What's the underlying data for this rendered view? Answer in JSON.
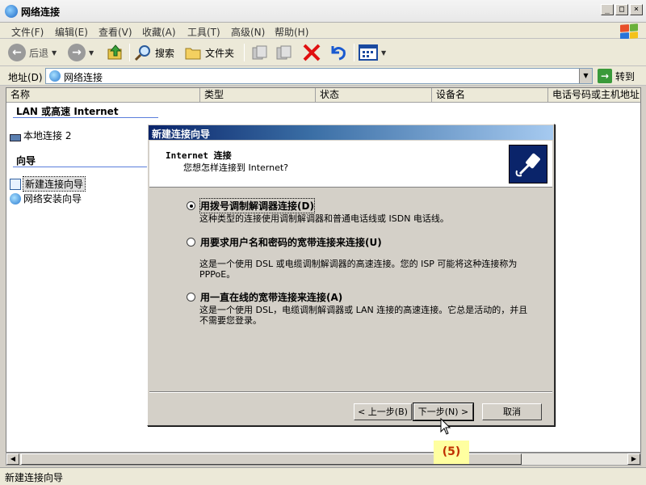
{
  "window": {
    "title": "网络连接"
  },
  "menu": [
    "文件(F)",
    "编辑(E)",
    "查看(V)",
    "收藏(A)",
    "工具(T)",
    "高级(N)",
    "帮助(H)"
  ],
  "toolbar": {
    "back": "后退",
    "search": "搜索",
    "folders": "文件夹"
  },
  "address": {
    "label": "地址(D)",
    "value": "网络连接",
    "go": "转到"
  },
  "columns": [
    "名称",
    "类型",
    "状态",
    "设备名",
    "电话号码或主机地址"
  ],
  "left": {
    "group_lan": "LAN 或高速 Internet",
    "local_connection": "本地连接 2",
    "group_wizard": "向导",
    "new_connection_wizard": "新建连接向导",
    "network_setup_wizard": "网络安装向导"
  },
  "status": {
    "text": "新建连接向导"
  },
  "dialog": {
    "title": "新建连接向导",
    "header_title": "Internet 连接",
    "header_subtitle": "您想怎样连接到 Internet?",
    "options": [
      {
        "label": "用拨号调制解调器连接(D)",
        "desc": "这种类型的连接使用调制解调器和普通电话线或 ISDN 电话线。",
        "selected": true
      },
      {
        "label": "用要求用户名和密码的宽带连接来连接(U)",
        "desc": "这是一个使用 DSL 或电缆调制解调器的高速连接。您的 ISP 可能将这种连接称为 PPPoE。",
        "selected": false
      },
      {
        "label": "用一直在线的宽带连接来连接(A)",
        "desc": "这是一个使用 DSL，电缆调制解调器或 LAN 连接的高速连接。它总是活动的，并且不需要您登录。",
        "selected": false
      }
    ],
    "buttons": {
      "back": "< 上一步(B)",
      "next": "下一步(N) >",
      "cancel": "取消"
    }
  },
  "annotation": {
    "callout": "(5)"
  },
  "colors": {
    "title_blue": "#0a246a",
    "callout_bg": "#ffffa0",
    "callout_text": "#c03000"
  }
}
